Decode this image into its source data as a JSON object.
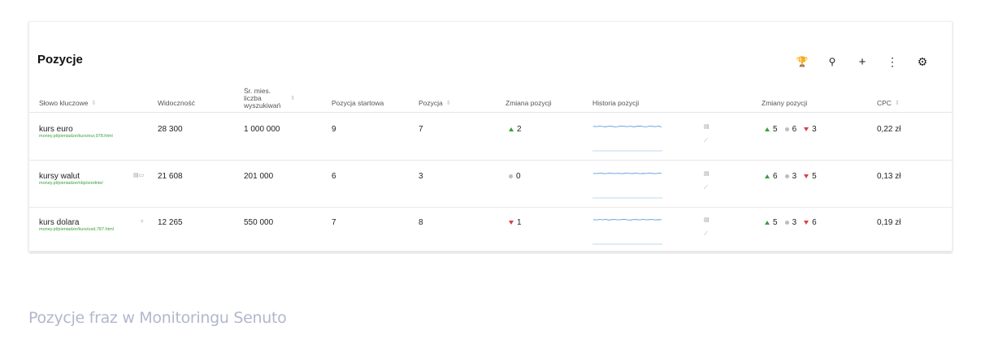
{
  "card": {
    "title": "Pozycje"
  },
  "toolbar": [
    {
      "icon": "trophy-icon",
      "glyph": "🏆"
    },
    {
      "icon": "search-icon",
      "glyph": "⚲"
    },
    {
      "icon": "plus-icon",
      "glyph": "+"
    },
    {
      "icon": "more-vertical-icon",
      "glyph": "⋮"
    },
    {
      "icon": "gear-icon",
      "glyph": "⚙"
    }
  ],
  "columns": {
    "keyword": "Słowo kluczowe",
    "visibility": "Widoczność",
    "volume_l1": "Śr. mies.",
    "volume_l2": "liczba",
    "volume_l3": "wyszukiwań",
    "start_pos": "Pozycja startowa",
    "position": "Pozycja",
    "change": "Zmiana pozycji",
    "history": "Historia pozycji",
    "changes": "Zmiany pozycji",
    "cpc": "CPC",
    "sort_glyph": "⇕"
  },
  "rows": [
    {
      "keyword": "kurs euro",
      "url": "money.pl/pieniadze/kurs/eur,978.html",
      "icon": "",
      "visibility": "28 300",
      "volume": "1 000 000",
      "start_pos": "9",
      "position": "7",
      "change_dir": "up",
      "change": "2",
      "spark": [
        3,
        3.2,
        2.8,
        3.1,
        3.3,
        2.9,
        3.0,
        3.4,
        3.1,
        2.8,
        3.0,
        3.2,
        2.9,
        3.3,
        3.0,
        2.7,
        3.1,
        3.4,
        2.9,
        3.0,
        3.2,
        2.8,
        3.5
      ],
      "ups": "5",
      "same": "6",
      "downs": "3",
      "cpc": "0,22 zł"
    },
    {
      "keyword": "kursy walut",
      "url": "money.pl/pieniadze/nbp/srednie/",
      "icon": "▤▭",
      "visibility": "21 608",
      "volume": "201 000",
      "start_pos": "6",
      "position": "3",
      "change_dir": "same",
      "change": "0",
      "spark": [
        3,
        3.1,
        2.9,
        3.0,
        3.2,
        2.8,
        3.0,
        3.1,
        2.9,
        3.2,
        3.0,
        2.8,
        3.1,
        3.0,
        2.9,
        3.2,
        3.0,
        3.1,
        2.8,
        3.0,
        3.2,
        2.9,
        3.0
      ],
      "ups": "6",
      "same": "3",
      "downs": "5",
      "cpc": "0,13 zł"
    },
    {
      "keyword": "kurs dolara",
      "url": "money.pl/pieniadze/kurs/usd,787.html",
      "icon": "▿",
      "visibility": "12 265",
      "volume": "550 000",
      "start_pos": "7",
      "position": "8",
      "change_dir": "down",
      "change": "1",
      "spark": [
        3,
        3.2,
        2.9,
        3.1,
        2.8,
        3.3,
        3.0,
        2.9,
        3.2,
        3.0,
        2.8,
        3.1,
        3.3,
        2.9,
        3.0,
        3.2,
        2.8,
        3.1,
        3.0,
        2.9,
        3.2,
        3.0,
        3.1
      ],
      "ups": "5",
      "same": "3",
      "downs": "6",
      "cpc": "0,19 zł"
    }
  ],
  "caption": "Pozycje fraz w Monitoringu Senuto",
  "colors": {
    "up": "#3aa03a",
    "down": "#d94141",
    "same": "#bdbdbd",
    "spark": "#4a90d9",
    "spark_base": "#a9cdea",
    "url": "#3aa03a"
  }
}
